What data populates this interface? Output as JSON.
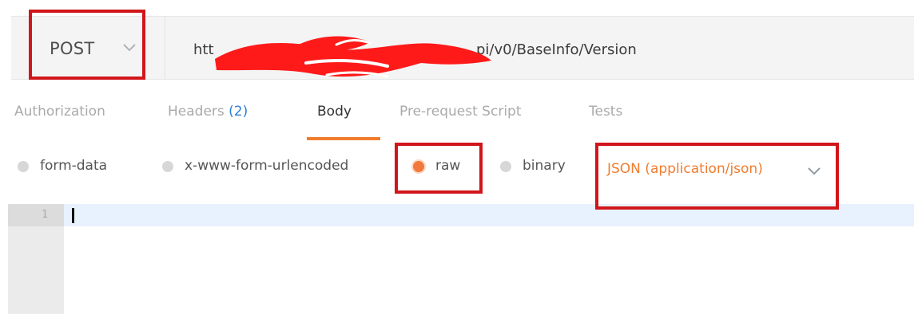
{
  "request": {
    "method": "POST",
    "url_start": "htt",
    "url_end": "pi/v0/BaseInfo/Version"
  },
  "tabs": [
    {
      "label": "Authorization"
    },
    {
      "label": "Headers ",
      "count": "(2)"
    },
    {
      "label": "Body",
      "active": true
    },
    {
      "label": "Pre-request Script"
    },
    {
      "label": "Tests"
    }
  ],
  "body_options": [
    {
      "label": "form-data",
      "selected": false
    },
    {
      "label": "x-www-form-urlencoded",
      "selected": false
    },
    {
      "label": "raw",
      "selected": true
    },
    {
      "label": "binary",
      "selected": false
    }
  ],
  "content_type": "JSON (application/json)",
  "editor": {
    "line_numbers": [
      "1"
    ]
  },
  "icons": {
    "method_dropdown": "chevron-down-icon",
    "content_type_dropdown": "chevron-down-icon"
  },
  "colors": {
    "accent_orange": "#f07c2e",
    "annotation_red": "#d1161b",
    "redaction_red": "#ff1a1a",
    "count_blue": "#2d7fd6"
  }
}
